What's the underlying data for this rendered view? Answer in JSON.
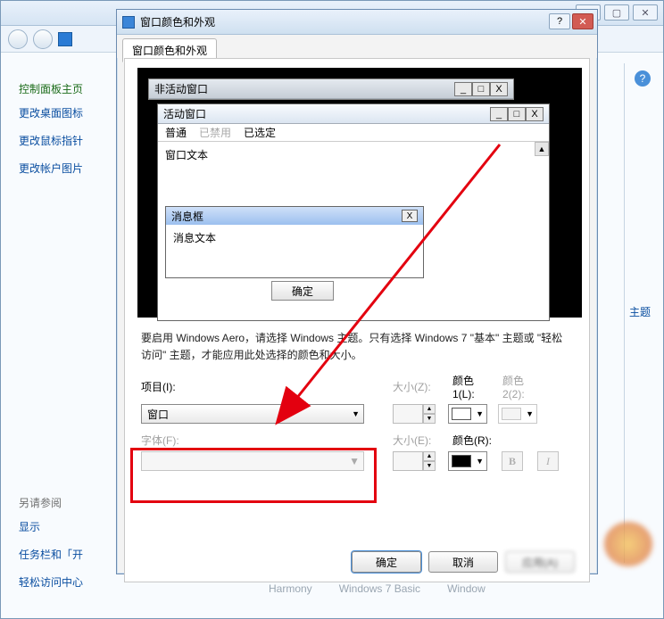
{
  "bg": {
    "sidebar_header": "控制面板主页",
    "links": [
      "更改桌面图标",
      "更改鼠标指针",
      "更改帐户图片"
    ],
    "seealso_header": "另请参阅",
    "seealso_links": [
      "显示",
      "任务栏和「开",
      "轻松访问中心"
    ],
    "footer": [
      "Harmony",
      "Windows 7 Basic",
      "Window"
    ],
    "right_hint": "主题",
    "help_icon": "?"
  },
  "dialog": {
    "title": "窗口颜色和外观",
    "tab": "窗口颜色和外观",
    "min": "—",
    "max": "▢",
    "close": "✕",
    "preview": {
      "inactive_title": "非活动窗口",
      "active_title": "活动窗口",
      "menu_normal": "普通",
      "menu_disabled": "已禁用",
      "menu_selected": "已选定",
      "window_text": "窗口文本",
      "msgbox_title": "消息框",
      "msgbox_text": "消息文本",
      "msgbox_ok": "确定",
      "scroll_up": "▲",
      "wb_min": "_",
      "wb_max": "□",
      "wb_close": "X"
    },
    "desc": "要启用 Windows Aero，请选择 Windows 主题。只有选择 Windows 7 \"基本\" 主题或 \"轻松访问\" 主题，才能应用此处选择的颜色和大小。",
    "labels": {
      "item": "项目(I):",
      "size_z": "大小(Z):",
      "color1": "颜色 1(L):",
      "color2": "颜色 2(2):",
      "font": "字体(F):",
      "size_e": "大小(E):",
      "color_r": "颜色(R):"
    },
    "item_value": "窗口",
    "color1_value": "#ffffff",
    "color_r_value": "#000000",
    "bold": "B",
    "italic": "I",
    "ok": "确定",
    "cancel": "取消",
    "apply": "应用(A)"
  }
}
